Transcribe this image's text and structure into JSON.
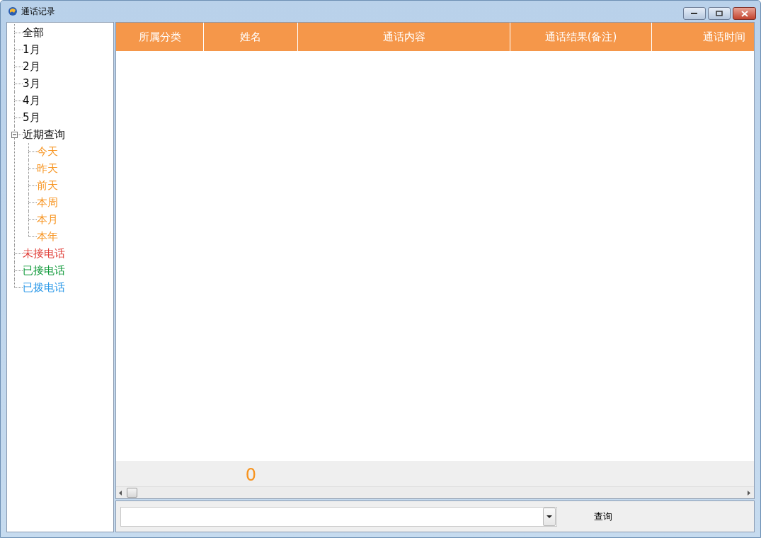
{
  "window": {
    "title": "通话记录"
  },
  "tree": [
    {
      "label": "全部"
    },
    {
      "label": "1月"
    },
    {
      "label": "2月"
    },
    {
      "label": "3月"
    },
    {
      "label": "4月"
    },
    {
      "label": "5月"
    },
    {
      "label": "近期查询",
      "expanded": true,
      "children": [
        {
          "label": "今天",
          "color": "#f7931e"
        },
        {
          "label": "昨天",
          "color": "#f7931e"
        },
        {
          "label": "前天",
          "color": "#f7931e"
        },
        {
          "label": "本周",
          "color": "#f7931e"
        },
        {
          "label": "本月",
          "color": "#f7931e"
        },
        {
          "label": "本年",
          "color": "#f7931e"
        }
      ]
    },
    {
      "label": "未接电话",
      "color": "#e0403a"
    },
    {
      "label": "已接电话",
      "color": "#109a3a"
    },
    {
      "label": "已拨电话",
      "color": "#2a98e8"
    }
  ],
  "table": {
    "columns": [
      "所属分类",
      "姓名",
      "通话内容",
      "通话结果(备注)",
      "通话时间"
    ],
    "count": "0"
  },
  "search": {
    "button": "查询"
  }
}
